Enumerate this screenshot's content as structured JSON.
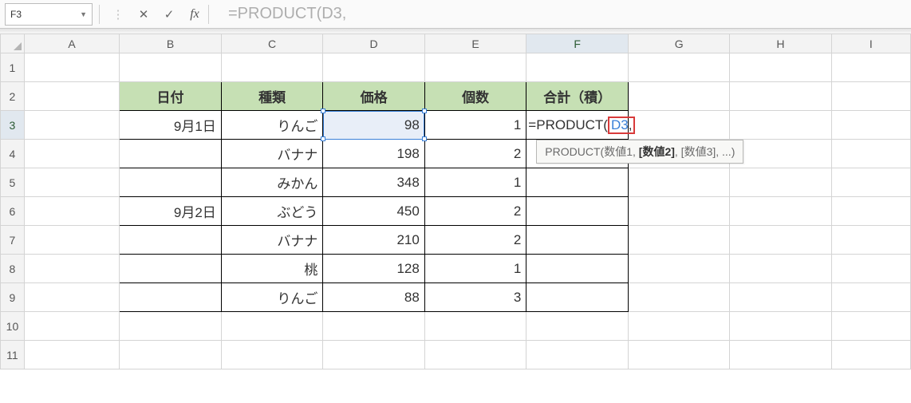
{
  "name_box": "F3",
  "formula_input": "=PRODUCT(D3,",
  "editing": {
    "prefix": "=PRODUCT(",
    "ref": "D3",
    "suffix": ","
  },
  "tooltip": {
    "func": "PRODUCT",
    "arg1": "数値1",
    "arg_cur": "[数値2]",
    "rest": ", [数値3], ...)"
  },
  "columns": [
    "A",
    "B",
    "C",
    "D",
    "E",
    "F",
    "G",
    "H",
    "I"
  ],
  "row_headers": [
    "1",
    "2",
    "3",
    "4",
    "5",
    "6",
    "7",
    "8",
    "9",
    "10",
    "11"
  ],
  "headers": {
    "date": "日付",
    "kind": "種類",
    "price": "価格",
    "qty": "個数",
    "total": "合計（積）"
  },
  "rows": [
    {
      "date": "9月1日",
      "kind": "りんご",
      "price": "98",
      "qty": "1"
    },
    {
      "date": "",
      "kind": "バナナ",
      "price": "198",
      "qty": "2"
    },
    {
      "date": "",
      "kind": "みかん",
      "price": "348",
      "qty": "1"
    },
    {
      "date": "9月2日",
      "kind": "ぶどう",
      "price": "450",
      "qty": "2"
    },
    {
      "date": "",
      "kind": "バナナ",
      "price": "210",
      "qty": "2"
    },
    {
      "date": "",
      "kind": "桃",
      "price": "128",
      "qty": "1"
    },
    {
      "date": "",
      "kind": "りんご",
      "price": "88",
      "qty": "3"
    }
  ]
}
